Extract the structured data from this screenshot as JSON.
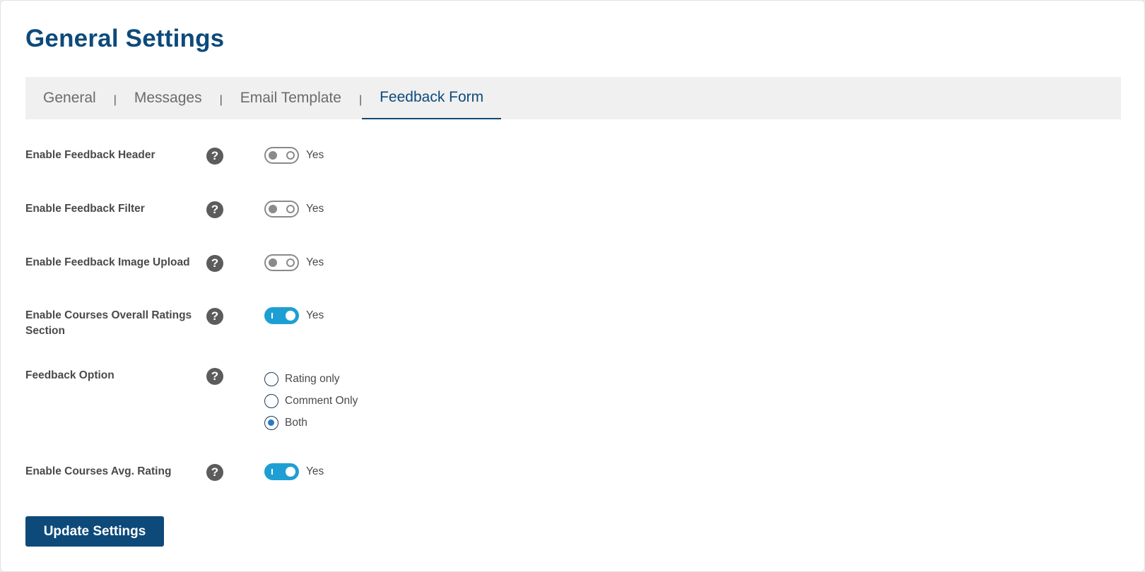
{
  "page": {
    "title": "General Settings"
  },
  "tabs": [
    {
      "label": "General",
      "active": false
    },
    {
      "label": "Messages",
      "active": false
    },
    {
      "label": "Email Template",
      "active": false
    },
    {
      "label": "Feedback Form",
      "active": true
    }
  ],
  "tab_separator": "|",
  "help_glyph": "?",
  "settings": {
    "feedback_header": {
      "label": "Enable Feedback Header",
      "toggle_text": "Yes",
      "enabled": false
    },
    "feedback_filter": {
      "label": "Enable Feedback Filter",
      "toggle_text": "Yes",
      "enabled": false
    },
    "feedback_image_upload": {
      "label": "Enable Feedback Image Upload",
      "toggle_text": "Yes",
      "enabled": false
    },
    "overall_ratings_section": {
      "label": "Enable Courses Overall Ratings Section",
      "toggle_text": "Yes",
      "enabled": true
    },
    "feedback_option": {
      "label": "Feedback Option",
      "options": [
        "Rating only",
        "Comment Only",
        "Both"
      ],
      "selected": "Both"
    },
    "avg_rating": {
      "label": "Enable Courses Avg. Rating",
      "toggle_text": "Yes",
      "enabled": true
    }
  },
  "actions": {
    "update_label": "Update Settings"
  },
  "colors": {
    "primary": "#0d4a7a",
    "toggle_on": "#1e9fd4",
    "toggle_off": "#8a8a8a",
    "tab_bar_bg": "#f0f0f0"
  },
  "icons": {
    "help": "question-circle-icon"
  }
}
